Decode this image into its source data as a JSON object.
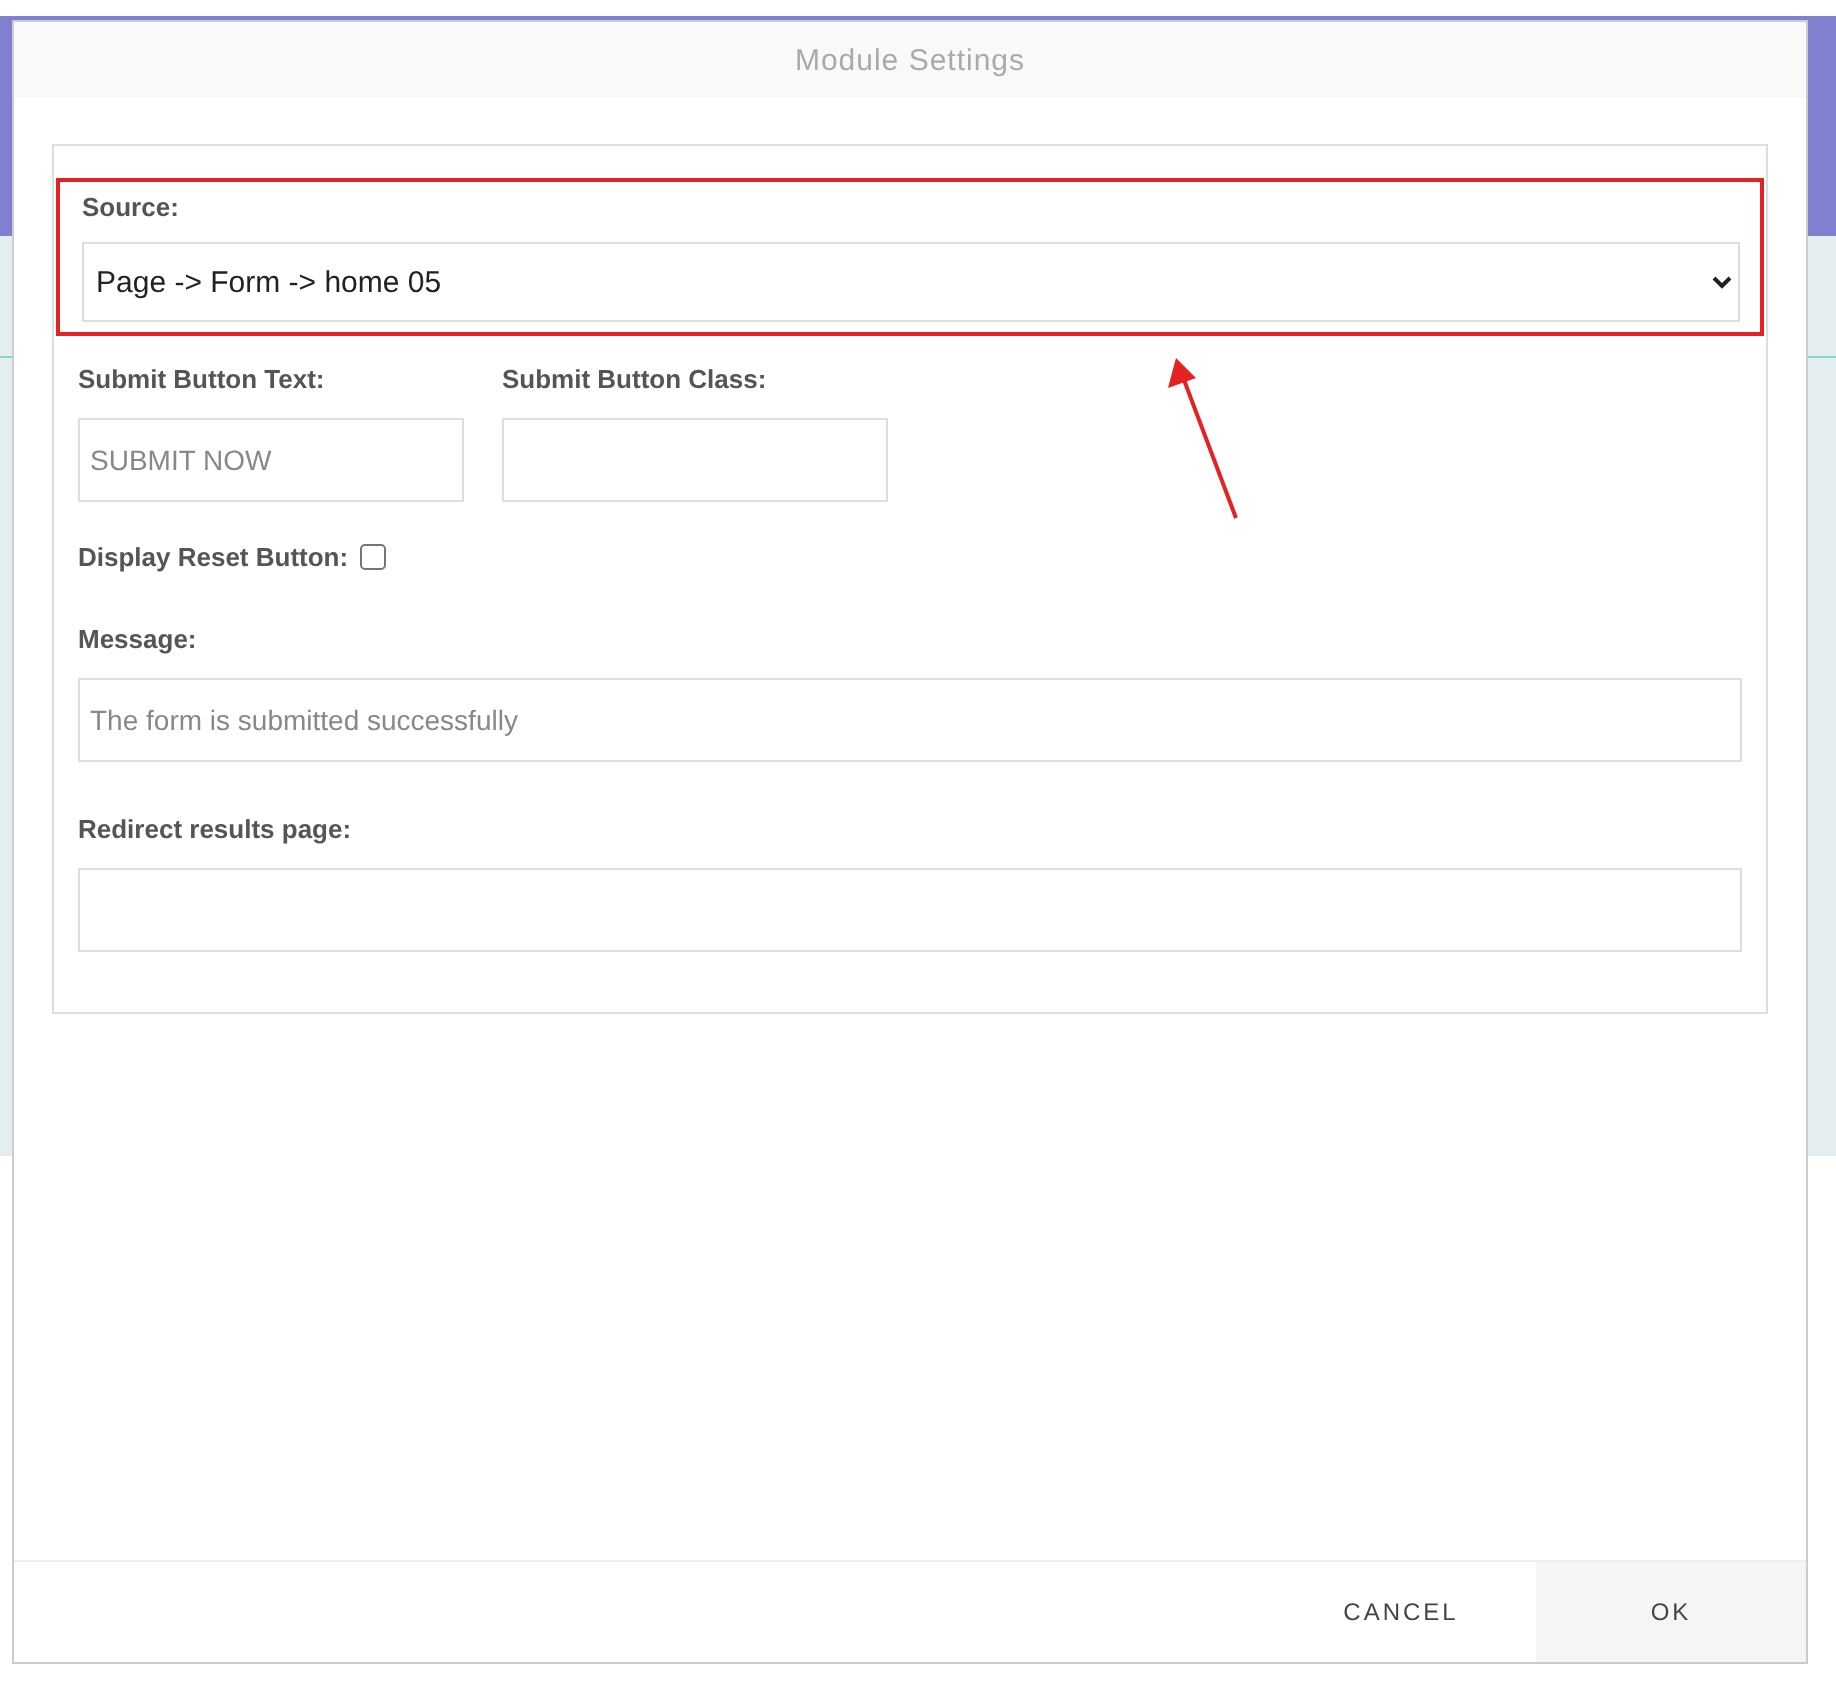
{
  "dialog": {
    "title": "Module Settings",
    "source": {
      "label": "Source:",
      "value": "Page -> Form -> home 05",
      "highlighted": true
    },
    "submit_text": {
      "label": "Submit Button Text:",
      "placeholder": "SUBMIT NOW"
    },
    "submit_class": {
      "label": "Submit Button Class:"
    },
    "reset": {
      "label": "Display Reset Button:",
      "checked": false
    },
    "message": {
      "label": "Message:",
      "placeholder": "The form is submitted successfully"
    },
    "redirect": {
      "label": "Redirect results page:"
    },
    "buttons": [
      {
        "label": "CANCEL",
        "kind": "plain"
      },
      {
        "label": "OK",
        "kind": "filled"
      }
    ]
  }
}
